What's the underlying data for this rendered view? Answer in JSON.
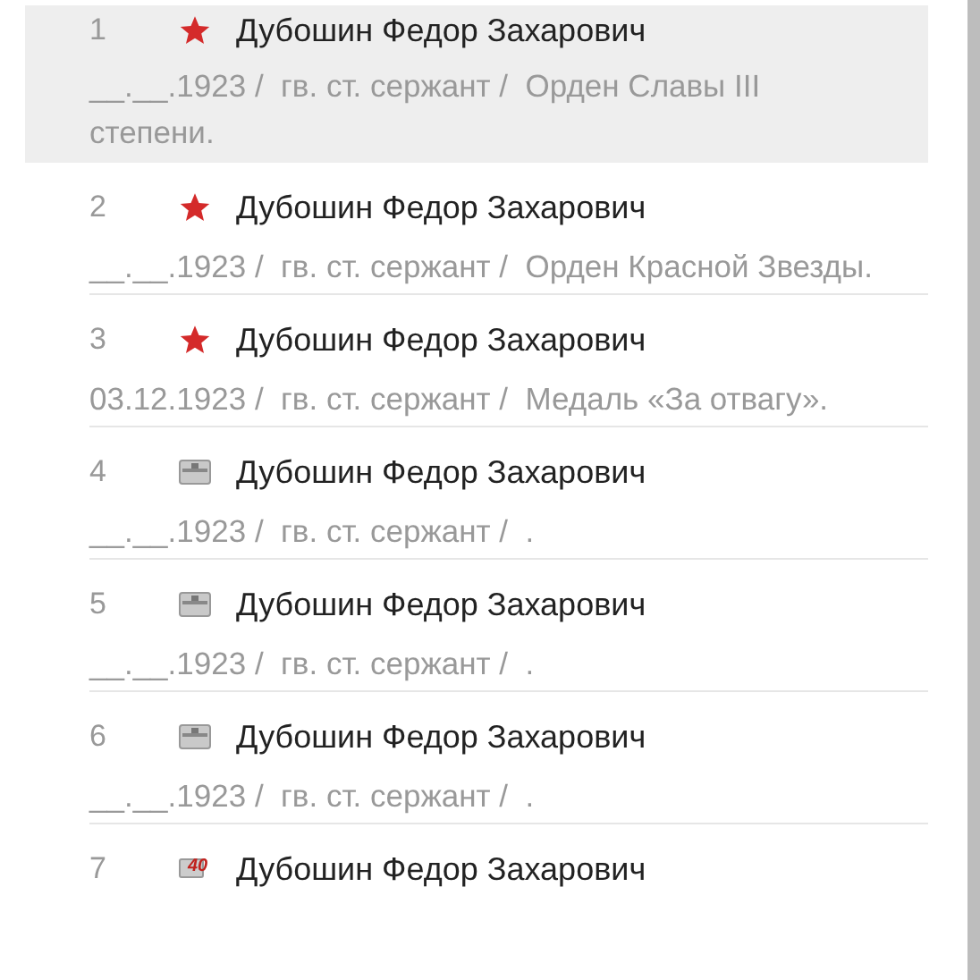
{
  "records": [
    {
      "number": "1",
      "kind": "star",
      "name": "Дубошин Федор Захарович",
      "details": "__.__.1923 /  гв. ст. сержант /  Орден Славы III степени.",
      "selected": true
    },
    {
      "number": "2",
      "kind": "star",
      "name": "Дубошин Федор Захарович",
      "details": "__.__.1923 /  гв. ст. сержант /  Орден Красной Звезды.",
      "selected": false
    },
    {
      "number": "3",
      "kind": "star",
      "name": "Дубошин Федор Захарович",
      "details": "03.12.1923 /  гв. ст. сержант /  Медаль «За отвагу».",
      "selected": false
    },
    {
      "number": "4",
      "kind": "document",
      "name": "Дубошин Федор Захарович",
      "details": "__.__.1923 /  гв. ст. сержант /  .",
      "selected": false
    },
    {
      "number": "5",
      "kind": "document",
      "name": "Дубошин Федор Захарович",
      "details": "__.__.1923 /  гв. ст. сержант /  .",
      "selected": false
    },
    {
      "number": "6",
      "kind": "document",
      "name": "Дубошин Федор Захарович",
      "details": "__.__.1923 /  гв. ст. сержант /  .",
      "selected": false
    },
    {
      "number": "7",
      "kind": "jubilee",
      "icon_text": "40",
      "name": "Дубошин Федор Захарович",
      "selected": false
    }
  ]
}
